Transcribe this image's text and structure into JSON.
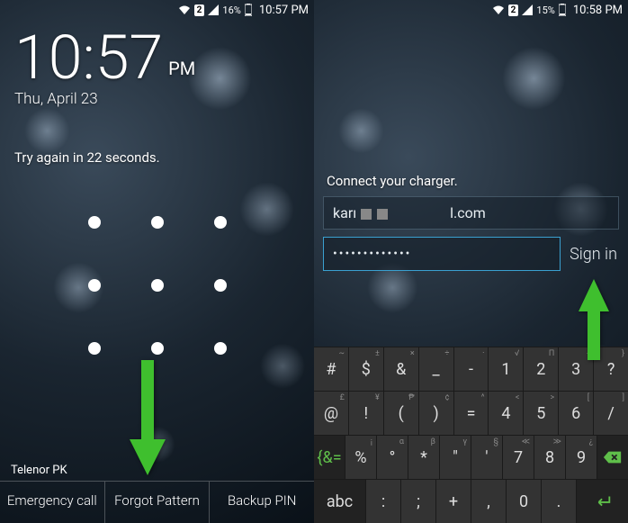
{
  "left": {
    "status": {
      "sim": "2",
      "battery_pct": "16%",
      "time": "10:57 PM"
    },
    "clock": {
      "hm": "10:57",
      "ampm": "PM",
      "date": "Thu, April 23"
    },
    "try_again": "Try again in 22 seconds.",
    "carrier": "Telenor PK",
    "buttons": {
      "emergency": "Emergency call",
      "forgot": "Forgot Pattern",
      "backup": "Backup PIN"
    }
  },
  "right": {
    "status": {
      "sim": "2",
      "battery_pct": "15%",
      "time": "10:58 PM"
    },
    "charger_msg": "Connect your charger.",
    "email_prefix": "karı",
    "email_suffix": "l.com",
    "password_mask": "•••••••••••••",
    "signin": "Sign in",
    "keyboard": {
      "row1_alts": [
        "~",
        "±",
        "×",
        "÷",
        "·",
        "√",
        "Π",
        "{",
        "}"
      ],
      "row1": [
        "#",
        "$",
        "&",
        "_",
        "-",
        "1",
        "2",
        "3",
        "?"
      ],
      "row2_alts": [
        "£",
        "¥",
        "₱",
        "¢",
        "^",
        "<",
        ">",
        "[",
        "]"
      ],
      "row2": [
        "@",
        "!",
        "(",
        ")",
        "=",
        "4",
        "5",
        "6",
        "/"
      ],
      "row3_alts": [
        "¡",
        "α",
        "β",
        "γ",
        "§",
        "≪",
        "≫",
        "¿"
      ],
      "row3_shift": "{&=",
      "row3": [
        "%",
        "°",
        "*",
        "\"",
        "'",
        "7",
        "8",
        "9"
      ],
      "row3_back": "⌫",
      "row4_abc": "abc",
      "row4": [
        ":",
        ";",
        "+",
        ",",
        "0",
        "."
      ],
      "row4_enter": "↵"
    }
  }
}
